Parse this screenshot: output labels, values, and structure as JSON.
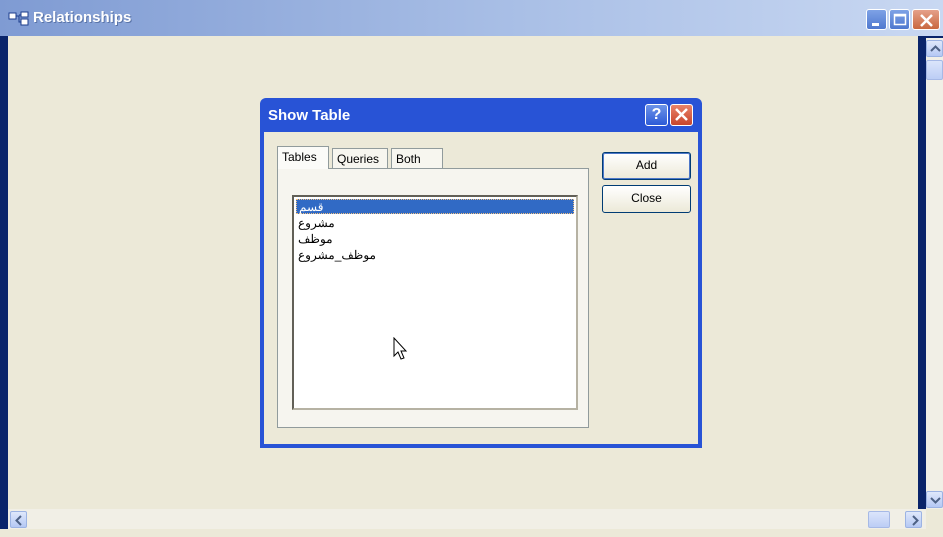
{
  "window": {
    "title": "Relationships",
    "title_icon": "relationships-icon",
    "controls": [
      "minimize-icon",
      "maximize-icon",
      "close-icon"
    ]
  },
  "dialog": {
    "title": "Show Table",
    "controls": [
      "help-icon",
      "close-icon"
    ],
    "help_glyph": "?",
    "tabs": [
      {
        "label": "Tables",
        "active": true
      },
      {
        "label": "Queries",
        "active": false
      },
      {
        "label": "Both",
        "active": false
      }
    ],
    "tables": [
      {
        "label": "قسم",
        "selected": true
      },
      {
        "label": "مشروع",
        "selected": false
      },
      {
        "label": "موظف",
        "selected": false
      },
      {
        "label": "موظف_مشروع",
        "selected": false
      }
    ],
    "buttons": {
      "add": "Add",
      "close": "Close"
    }
  },
  "colors": {
    "titlebar_start": "#7f9bd3",
    "dialog_frame": "#2853d6",
    "client_bg": "#ece9d8",
    "selection": "#316ac5"
  }
}
